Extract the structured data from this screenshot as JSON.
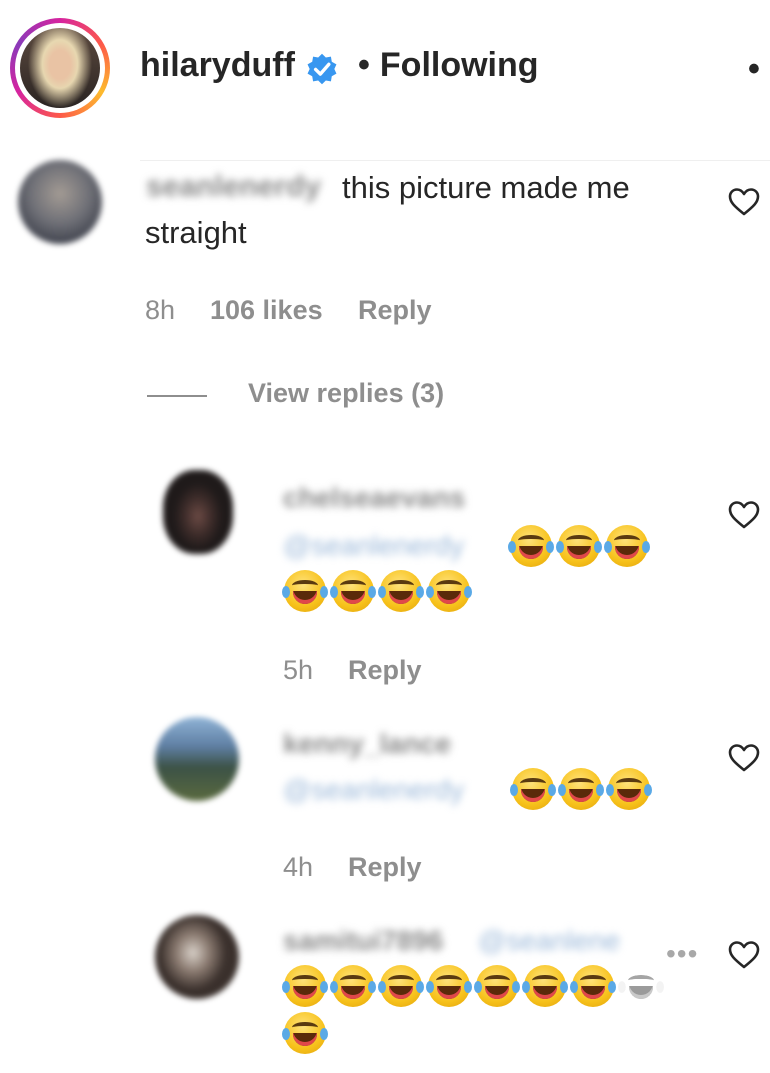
{
  "header": {
    "username": "hilaryduff",
    "separator": "•",
    "follow_status": "Following",
    "more_label": "•",
    "icons": [
      "verified-badge-icon"
    ],
    "colors": {
      "verified": "#3897f0",
      "ring": "#d6249f"
    }
  },
  "comment": {
    "username_blurred": "seanlenerdy",
    "text_line1": "this picture made me",
    "text_line2": "straight",
    "time": "8h",
    "likes": "106 likes",
    "reply_label": "Reply",
    "view_replies": "View replies (3)"
  },
  "replies": [
    {
      "username_blurred": "chelseaevans",
      "mention_blurred": "@seanlenerdy",
      "emoji_count": 7,
      "time": "5h",
      "reply_label": "Reply"
    },
    {
      "username_blurred": "kenny_lance",
      "mention_blurred": "@seanlenerdy",
      "emoji_count": 3,
      "time": "4h",
      "reply_label": "Reply"
    },
    {
      "username_blurred": "samitui7896",
      "mention_blurred": "@seanlene",
      "more_label": "•••",
      "emoji_count": 9
    }
  ],
  "icons": {
    "heart": "heart-outline-icon",
    "emoji": "face-with-tears-of-joy"
  }
}
